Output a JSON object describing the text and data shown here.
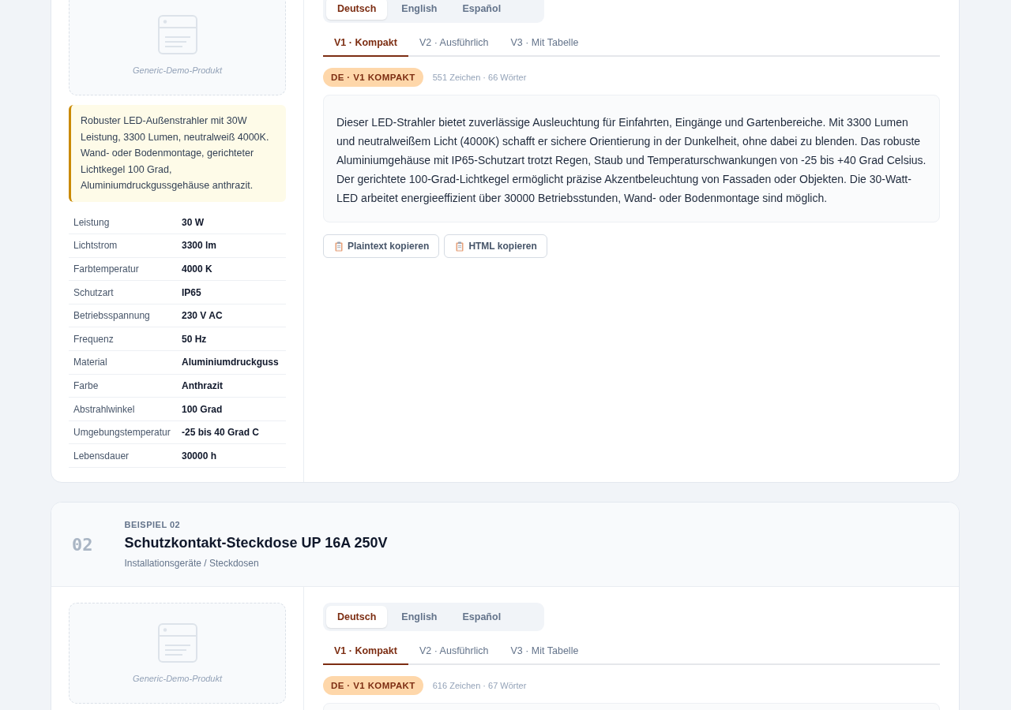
{
  "examples": [
    {
      "image_label": "Generic-Demo-Produkt",
      "summary": "Robuster LED-Außenstrahler mit 30W Leistung, 3300 Lumen, neutralweiß 4000K. Wand- oder Bodenmontage, gerichteter Lichtkegel 100 Grad, Aluminiumdruckgussgehäuse anthrazit.",
      "specs": [
        {
          "label": "Leistung",
          "value": "30 W"
        },
        {
          "label": "Lichtstrom",
          "value": "3300 lm"
        },
        {
          "label": "Farbtemperatur",
          "value": "4000 K"
        },
        {
          "label": "Schutzart",
          "value": "IP65"
        },
        {
          "label": "Betriebsspannung",
          "value": "230 V AC"
        },
        {
          "label": "Frequenz",
          "value": "50 Hz"
        },
        {
          "label": "Material",
          "value": "Aluminiumdruckguss"
        },
        {
          "label": "Farbe",
          "value": "Anthrazit"
        },
        {
          "label": "Abstrahlwinkel",
          "value": "100 Grad"
        },
        {
          "label": "Umgebungstemperatur",
          "value": "-25 bis 40 Grad C"
        },
        {
          "label": "Lebensdauer",
          "value": "30000 h"
        }
      ],
      "languages": [
        {
          "label": "Deutsch",
          "selected": true
        },
        {
          "label": "English",
          "selected": false
        },
        {
          "label": "Español",
          "selected": false
        }
      ],
      "versions": [
        {
          "label": "V1 · Kompakt",
          "selected": true
        },
        {
          "label": "V2 · Ausführlich",
          "selected": false
        },
        {
          "label": "V3 · Mit Tabelle",
          "selected": false
        }
      ],
      "badge": "DE · V1 KOMPAKT",
      "stats": "551 Zeichen · 66 Wörter",
      "description": "Dieser LED-Strahler bietet zuverlässige Ausleuchtung für Einfahrten, Eingänge und Gartenbereiche. Mit 3300 Lumen und neutralweißem Licht (4000K) schafft er sichere Orientierung in der Dunkelheit, ohne dabei zu blenden. Das robuste Aluminiumgehäuse mit IP65-Schutzart trotzt Regen, Staub und Temperaturschwankungen von -25 bis +40 Grad Celsius. Der gerichtete 100-Grad-Lichtkegel ermöglicht präzise Akzentbeleuchtung von Fassaden oder Objekten. Die 30-Watt-LED arbeitet energieeffizient über 30000 Betriebsstunden, Wand- oder Bodenmontage sind möglich.",
      "actions": [
        "Plaintext kopieren",
        "HTML kopieren"
      ]
    },
    {
      "number": "02",
      "eyebrow": "BEISPIEL 02",
      "title": "Schutzkontakt-Steckdose UP 16A 250V",
      "category": "Installationsgeräte / Steckdosen",
      "image_label": "Generic-Demo-Produkt",
      "languages": [
        {
          "label": "Deutsch",
          "selected": true
        },
        {
          "label": "English",
          "selected": false
        },
        {
          "label": "Español",
          "selected": false
        }
      ],
      "versions": [
        {
          "label": "V1 · Kompakt",
          "selected": true
        },
        {
          "label": "V2 · Ausführlich",
          "selected": false
        },
        {
          "label": "V3 · Mit Tabelle",
          "selected": false
        }
      ],
      "badge": "DE · V1 KOMPAKT",
      "stats": "616 Zeichen · 67 Wörter"
    }
  ]
}
